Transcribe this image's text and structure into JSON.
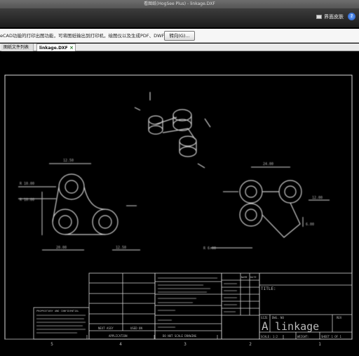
{
  "window": {
    "title": "看图纸(HogSee Plus) - linkage.DXF"
  },
  "toolbar": {
    "skin_label": "界面皮肤",
    "skin_icon": "monitor-icon",
    "help_icon": "help-icon"
  },
  "infobar": {
    "message": "eCAD功能的打印出图功能，可将图纸输出到打印机，绘图仪以及生成PDF、DWF等",
    "convert_label": "转向(G)..."
  },
  "tabs": [
    {
      "label": "图纸文件列表",
      "active": false
    },
    {
      "label": "linkage.DXF",
      "active": true,
      "close": "×"
    }
  ],
  "drawing": {
    "title_label": "TITLE:",
    "size_label": "SIZE",
    "dwg_no_label": "DWG. NO",
    "rev_label": "REV",
    "size_value": "A",
    "drawing_name": "linkage",
    "scale_label": "SCALE: 1:2",
    "weight_label": "WEIGHT:",
    "sheet_label": "SHEET 1 OF 1",
    "next_assy": "NEXT ASSY",
    "used_on": "USED ON",
    "application": "APPLICATION",
    "proprietary_title": "PROPRIETARY AND CONFIDENTIAL",
    "do_not_scale": "DO NOT SCALE DRAWING",
    "name_label": "NAME",
    "date_label": "DATE",
    "zone_numbers": [
      "5",
      "4",
      "3",
      "2",
      "1"
    ],
    "dim_labels": [
      "R 10.00",
      "R 10.00",
      "12.50",
      "20.00",
      "12.50",
      "R 6.00",
      "24.00",
      "12.00",
      "6.00"
    ]
  }
}
